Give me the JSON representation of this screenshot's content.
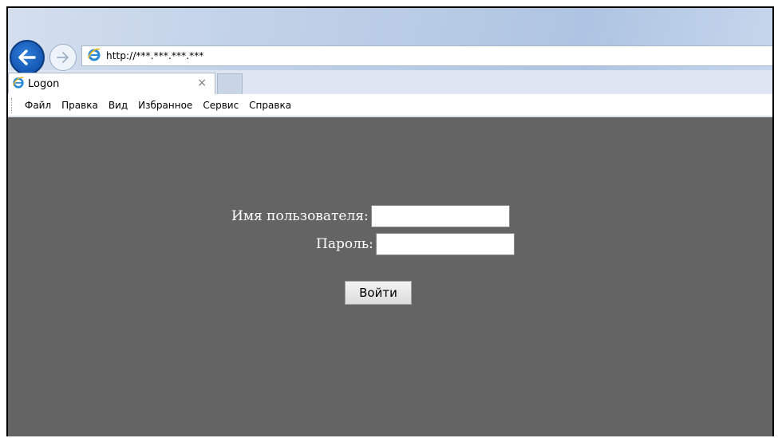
{
  "browser": {
    "address": "http://***.***.***.***",
    "tab_title": "Logon",
    "tab_close": "×",
    "menu": [
      "Файл",
      "Правка",
      "Вид",
      "Избранное",
      "Сервис",
      "Справка"
    ]
  },
  "login_form": {
    "username_label": "Имя пользователя:",
    "username_value": "",
    "password_label": "Пароль:",
    "password_value": "",
    "submit_label": "Войти"
  },
  "colors": {
    "content_background": "#646464",
    "back_button": "#1457b3"
  },
  "icons": {
    "back": "arrow-left-icon",
    "forward": "arrow-right-icon",
    "site": "internet-explorer-icon"
  }
}
